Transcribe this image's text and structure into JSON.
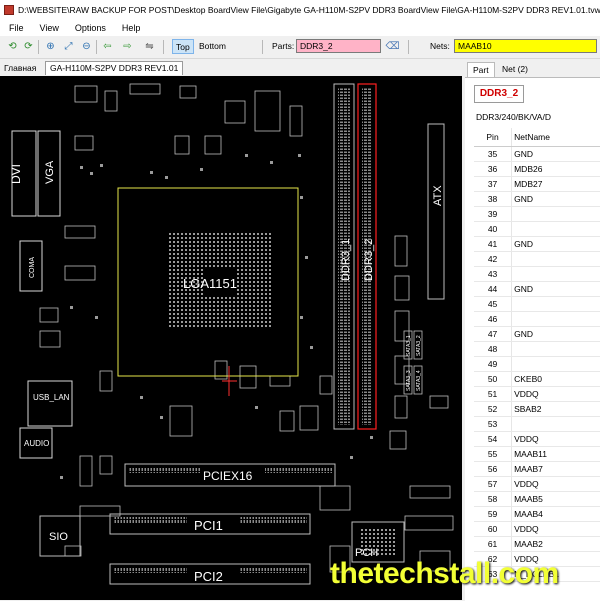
{
  "window": {
    "title": "D:\\WEBSITE\\RAW BACKUP FOR POST\\Desktop BoardView File\\Gigabyte GA-H110M-S2PV DDR3 BoardView File\\GA-H110M-S2PV DDR3 REV1.01.tvw"
  },
  "menu": [
    "File",
    "View",
    "Options",
    "Help"
  ],
  "toolbar": {
    "top_label": "Top",
    "bottom_label": "Bottom",
    "parts_label": "Parts:",
    "parts_value": "DDR3_2",
    "nets_label": "Nets:",
    "nets_value": "MAAB10"
  },
  "doc_tabs": {
    "home": "Главная",
    "file": "GA-H110M-S2PV DDR3 REV1.01"
  },
  "board": {
    "labels": {
      "dvi": "DVI",
      "vga": "VGA",
      "coma": "COMA",
      "usb_lan": "USB_LAN",
      "audio": "AUDIO",
      "cpu": "LGA1151",
      "ddr3_1": "DDR3_1",
      "ddr3_2": "DDR3_2",
      "atx": "ATX",
      "pciex16": "PCIEX16",
      "pci1": "PCI1",
      "pci2": "PCI2",
      "sio": "SIO",
      "pch": "PCH",
      "sata": [
        "SATA3_1",
        "SATA3_2",
        "SATA3_3",
        "SATA3_4"
      ]
    }
  },
  "panel": {
    "tabs": [
      "Part",
      "Net (2)"
    ],
    "part_name": "DDR3_2",
    "part_desc": "DDR3/240/BK/VA/D",
    "columns": [
      "Pin",
      "NetName"
    ],
    "rows": [
      [
        "35",
        "GND"
      ],
      [
        "36",
        "MDB26"
      ],
      [
        "37",
        "MDB27"
      ],
      [
        "38",
        "GND"
      ],
      [
        "39",
        ""
      ],
      [
        "40",
        ""
      ],
      [
        "41",
        "GND"
      ],
      [
        "42",
        ""
      ],
      [
        "43",
        ""
      ],
      [
        "44",
        "GND"
      ],
      [
        "45",
        ""
      ],
      [
        "46",
        ""
      ],
      [
        "47",
        "GND"
      ],
      [
        "48",
        ""
      ],
      [
        "49",
        ""
      ],
      [
        "50",
        "CKEB0"
      ],
      [
        "51",
        "VDDQ"
      ],
      [
        "52",
        "SBAB2"
      ],
      [
        "53",
        ""
      ],
      [
        "54",
        "VDDQ"
      ],
      [
        "55",
        "MAAB11"
      ],
      [
        "56",
        "MAAB7"
      ],
      [
        "57",
        "VDDQ"
      ],
      [
        "58",
        "MAAB5"
      ],
      [
        "59",
        "MAAB4"
      ],
      [
        "60",
        "VDDQ"
      ],
      [
        "61",
        "MAAB2"
      ],
      [
        "62",
        "VDDQ"
      ],
      [
        "63",
        "M_DCLKB1"
      ]
    ]
  },
  "watermark": "thetechstall.com",
  "colors": {
    "highlight": "#ff2020",
    "parts_bg": "#ffb3c7",
    "nets_bg": "#ffff00",
    "cpu_outline": "#e6e64a",
    "board_bg": "#000000",
    "watermark": "#f2ff35"
  }
}
